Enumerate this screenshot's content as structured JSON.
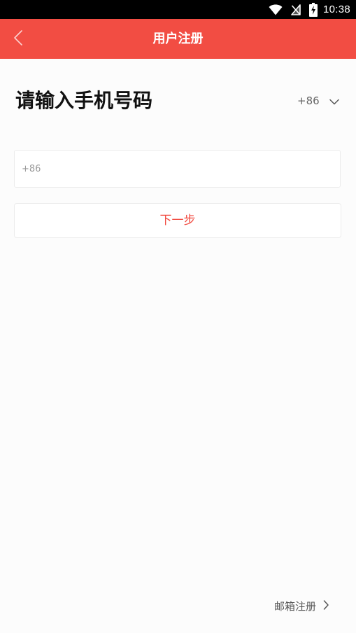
{
  "status_bar": {
    "time": "10:38",
    "icons": [
      "wifi-icon",
      "no-signal-icon",
      "battery-charging-icon"
    ]
  },
  "app_bar": {
    "title": "用户注册",
    "back_icon": "chevron-left-icon",
    "background_color": "#f24d43"
  },
  "main": {
    "heading": "请输入手机号码",
    "country_code": "+86",
    "country_chevron_icon": "chevron-down-icon",
    "phone_input": {
      "value": "",
      "placeholder": "+86"
    },
    "next_button_label": "下一步"
  },
  "footer": {
    "email_register_label": "邮箱注册",
    "email_register_icon": "chevron-right-icon"
  },
  "colors": {
    "accent": "#f24d43",
    "page_background": "#fcfcfc"
  }
}
